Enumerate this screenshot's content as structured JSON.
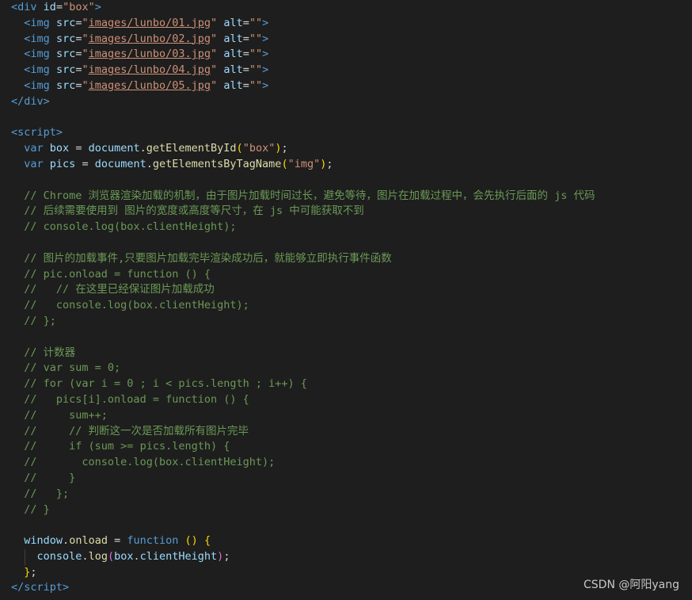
{
  "editor": {
    "lines": [
      {
        "guides": [],
        "tokens": [
          [
            "<",
            "t-tag"
          ],
          [
            "div",
            "t-tag"
          ],
          [
            " ",
            "t-op"
          ],
          [
            "id",
            "t-attr"
          ],
          [
            "=",
            "t-op"
          ],
          [
            "\"box\"",
            "t-str"
          ],
          [
            ">",
            "t-tag"
          ]
        ]
      },
      {
        "guides": [],
        "tokens": [
          [
            "  ",
            "t-op"
          ],
          [
            "<",
            "t-tag"
          ],
          [
            "img",
            "t-tag"
          ],
          [
            " ",
            "t-op"
          ],
          [
            "src",
            "t-attr"
          ],
          [
            "=",
            "t-op"
          ],
          [
            "\"",
            "t-str"
          ],
          [
            "images/lunbo/01.jpg",
            "t-link"
          ],
          [
            "\"",
            "t-str"
          ],
          [
            " ",
            "t-op"
          ],
          [
            "alt",
            "t-attr"
          ],
          [
            "=",
            "t-op"
          ],
          [
            "\"\"",
            "t-str"
          ],
          [
            ">",
            "t-tag"
          ]
        ]
      },
      {
        "guides": [],
        "tokens": [
          [
            "  ",
            "t-op"
          ],
          [
            "<",
            "t-tag"
          ],
          [
            "img",
            "t-tag"
          ],
          [
            " ",
            "t-op"
          ],
          [
            "src",
            "t-attr"
          ],
          [
            "=",
            "t-op"
          ],
          [
            "\"",
            "t-str"
          ],
          [
            "images/lunbo/02.jpg",
            "t-link"
          ],
          [
            "\"",
            "t-str"
          ],
          [
            " ",
            "t-op"
          ],
          [
            "alt",
            "t-attr"
          ],
          [
            "=",
            "t-op"
          ],
          [
            "\"\"",
            "t-str"
          ],
          [
            ">",
            "t-tag"
          ]
        ]
      },
      {
        "guides": [],
        "tokens": [
          [
            "  ",
            "t-op"
          ],
          [
            "<",
            "t-tag"
          ],
          [
            "img",
            "t-tag"
          ],
          [
            " ",
            "t-op"
          ],
          [
            "src",
            "t-attr"
          ],
          [
            "=",
            "t-op"
          ],
          [
            "\"",
            "t-str"
          ],
          [
            "images/lunbo/03.jpg",
            "t-link"
          ],
          [
            "\"",
            "t-str"
          ],
          [
            " ",
            "t-op"
          ],
          [
            "alt",
            "t-attr"
          ],
          [
            "=",
            "t-op"
          ],
          [
            "\"\"",
            "t-str"
          ],
          [
            ">",
            "t-tag"
          ]
        ]
      },
      {
        "guides": [],
        "tokens": [
          [
            "  ",
            "t-op"
          ],
          [
            "<",
            "t-tag"
          ],
          [
            "img",
            "t-tag"
          ],
          [
            " ",
            "t-op"
          ],
          [
            "src",
            "t-attr"
          ],
          [
            "=",
            "t-op"
          ],
          [
            "\"",
            "t-str"
          ],
          [
            "images/lunbo/04.jpg",
            "t-link"
          ],
          [
            "\"",
            "t-str"
          ],
          [
            " ",
            "t-op"
          ],
          [
            "alt",
            "t-attr"
          ],
          [
            "=",
            "t-op"
          ],
          [
            "\"\"",
            "t-str"
          ],
          [
            ">",
            "t-tag"
          ]
        ]
      },
      {
        "guides": [],
        "tokens": [
          [
            "  ",
            "t-op"
          ],
          [
            "<",
            "t-tag"
          ],
          [
            "img",
            "t-tag"
          ],
          [
            " ",
            "t-op"
          ],
          [
            "src",
            "t-attr"
          ],
          [
            "=",
            "t-op"
          ],
          [
            "\"",
            "t-str"
          ],
          [
            "images/lunbo/05.jpg",
            "t-link"
          ],
          [
            "\"",
            "t-str"
          ],
          [
            " ",
            "t-op"
          ],
          [
            "alt",
            "t-attr"
          ],
          [
            "=",
            "t-op"
          ],
          [
            "\"\"",
            "t-str"
          ],
          [
            ">",
            "t-tag"
          ]
        ]
      },
      {
        "guides": [],
        "tokens": [
          [
            "</",
            "t-tag"
          ],
          [
            "div",
            "t-tag"
          ],
          [
            ">",
            "t-tag"
          ]
        ]
      },
      {
        "guides": [],
        "tokens": []
      },
      {
        "guides": [],
        "tokens": [
          [
            "<",
            "t-tag"
          ],
          [
            "script",
            "t-tag"
          ],
          [
            ">",
            "t-tag"
          ]
        ]
      },
      {
        "guides": [],
        "tokens": [
          [
            "  ",
            "t-op"
          ],
          [
            "var",
            "t-kw"
          ],
          [
            " ",
            "t-op"
          ],
          [
            "box",
            "t-var"
          ],
          [
            " = ",
            "t-op"
          ],
          [
            "document",
            "t-var"
          ],
          [
            ".",
            "t-op"
          ],
          [
            "getElementById",
            "t-fn"
          ],
          [
            "(",
            "t-p1"
          ],
          [
            "\"box\"",
            "t-str"
          ],
          [
            ")",
            "t-p1"
          ],
          [
            ";",
            "t-op"
          ]
        ]
      },
      {
        "guides": [],
        "tokens": [
          [
            "  ",
            "t-op"
          ],
          [
            "var",
            "t-kw"
          ],
          [
            " ",
            "t-op"
          ],
          [
            "pics",
            "t-var"
          ],
          [
            " = ",
            "t-op"
          ],
          [
            "document",
            "t-var"
          ],
          [
            ".",
            "t-op"
          ],
          [
            "getElementsByTagName",
            "t-fn"
          ],
          [
            "(",
            "t-p1"
          ],
          [
            "\"img\"",
            "t-str"
          ],
          [
            ")",
            "t-p1"
          ],
          [
            ";",
            "t-op"
          ]
        ]
      },
      {
        "guides": [],
        "tokens": []
      },
      {
        "guides": [],
        "tokens": [
          [
            "  ",
            "t-op"
          ],
          [
            "// Chrome 浏览器渲染加载的机制，由于图片加载时间过长，避免等待，图片在加载过程中，会先执行后面的 js 代码",
            "t-cm"
          ]
        ]
      },
      {
        "guides": [],
        "tokens": [
          [
            "  ",
            "t-op"
          ],
          [
            "// 后续需要使用到 图片的宽度或高度等尺寸，在 js 中可能获取不到",
            "t-cm"
          ]
        ]
      },
      {
        "guides": [],
        "tokens": [
          [
            "  ",
            "t-op"
          ],
          [
            "// console.log(box.clientHeight);",
            "t-cm"
          ]
        ]
      },
      {
        "guides": [],
        "tokens": []
      },
      {
        "guides": [],
        "tokens": [
          [
            "  ",
            "t-op"
          ],
          [
            "// 图片的加载事件,只要图片加载完毕渲染成功后，就能够立即执行事件函数",
            "t-cm"
          ]
        ]
      },
      {
        "guides": [],
        "tokens": [
          [
            "  ",
            "t-op"
          ],
          [
            "// pic.onload = function () {",
            "t-cm"
          ]
        ]
      },
      {
        "guides": [],
        "tokens": [
          [
            "  ",
            "t-op"
          ],
          [
            "//   // 在这里已经保证图片加载成功",
            "t-cm"
          ]
        ]
      },
      {
        "guides": [],
        "tokens": [
          [
            "  ",
            "t-op"
          ],
          [
            "//   console.log(box.clientHeight);",
            "t-cm"
          ]
        ]
      },
      {
        "guides": [],
        "tokens": [
          [
            "  ",
            "t-op"
          ],
          [
            "// };",
            "t-cm"
          ]
        ]
      },
      {
        "guides": [],
        "tokens": []
      },
      {
        "guides": [],
        "tokens": [
          [
            "  ",
            "t-op"
          ],
          [
            "// 计数器",
            "t-cm"
          ]
        ]
      },
      {
        "guides": [],
        "tokens": [
          [
            "  ",
            "t-op"
          ],
          [
            "// var sum = 0;",
            "t-cm"
          ]
        ]
      },
      {
        "guides": [],
        "tokens": [
          [
            "  ",
            "t-op"
          ],
          [
            "// for (var i = 0 ; i < pics.length ; i++) {",
            "t-cm"
          ]
        ]
      },
      {
        "guides": [],
        "tokens": [
          [
            "  ",
            "t-op"
          ],
          [
            "//   pics[i].onload = function () {",
            "t-cm"
          ]
        ]
      },
      {
        "guides": [],
        "tokens": [
          [
            "  ",
            "t-op"
          ],
          [
            "//     sum++;",
            "t-cm"
          ]
        ]
      },
      {
        "guides": [],
        "tokens": [
          [
            "  ",
            "t-op"
          ],
          [
            "//     // 判断这一次是否加载所有图片完毕",
            "t-cm"
          ]
        ]
      },
      {
        "guides": [],
        "tokens": [
          [
            "  ",
            "t-op"
          ],
          [
            "//     if (sum >= pics.length) {",
            "t-cm"
          ]
        ]
      },
      {
        "guides": [],
        "tokens": [
          [
            "  ",
            "t-op"
          ],
          [
            "//       console.log(box.clientHeight);",
            "t-cm"
          ]
        ]
      },
      {
        "guides": [],
        "tokens": [
          [
            "  ",
            "t-op"
          ],
          [
            "//     }",
            "t-cm"
          ]
        ]
      },
      {
        "guides": [],
        "tokens": [
          [
            "  ",
            "t-op"
          ],
          [
            "//   };",
            "t-cm"
          ]
        ]
      },
      {
        "guides": [],
        "tokens": [
          [
            "  ",
            "t-op"
          ],
          [
            "// }",
            "t-cm"
          ]
        ]
      },
      {
        "guides": [],
        "tokens": []
      },
      {
        "guides": [],
        "tokens": [
          [
            "  ",
            "t-op"
          ],
          [
            "window",
            "t-var"
          ],
          [
            ".",
            "t-op"
          ],
          [
            "onload",
            "t-fn"
          ],
          [
            " = ",
            "t-op"
          ],
          [
            "function",
            "t-kw"
          ],
          [
            " ",
            "t-op"
          ],
          [
            "()",
            "t-p1"
          ],
          [
            " ",
            "t-op"
          ],
          [
            "{",
            "t-p1"
          ]
        ]
      },
      {
        "guides": [
          1
        ],
        "tokens": [
          [
            "    ",
            "t-op"
          ],
          [
            "console",
            "t-var"
          ],
          [
            ".",
            "t-op"
          ],
          [
            "log",
            "t-fn"
          ],
          [
            "(",
            "t-p2"
          ],
          [
            "box",
            "t-var"
          ],
          [
            ".",
            "t-op"
          ],
          [
            "clientHeight",
            "t-var"
          ],
          [
            ")",
            "t-p2"
          ],
          [
            ";",
            "t-op"
          ]
        ]
      },
      {
        "guides": [],
        "tokens": [
          [
            "  ",
            "t-op"
          ],
          [
            "}",
            "t-p1"
          ],
          [
            ";",
            "t-op"
          ]
        ]
      },
      {
        "guides": [],
        "tokens": [
          [
            "</",
            "t-tag"
          ],
          [
            "script",
            "t-tag"
          ],
          [
            ">",
            "t-tag"
          ]
        ]
      }
    ]
  },
  "watermark": "CSDN @阿阳yang"
}
